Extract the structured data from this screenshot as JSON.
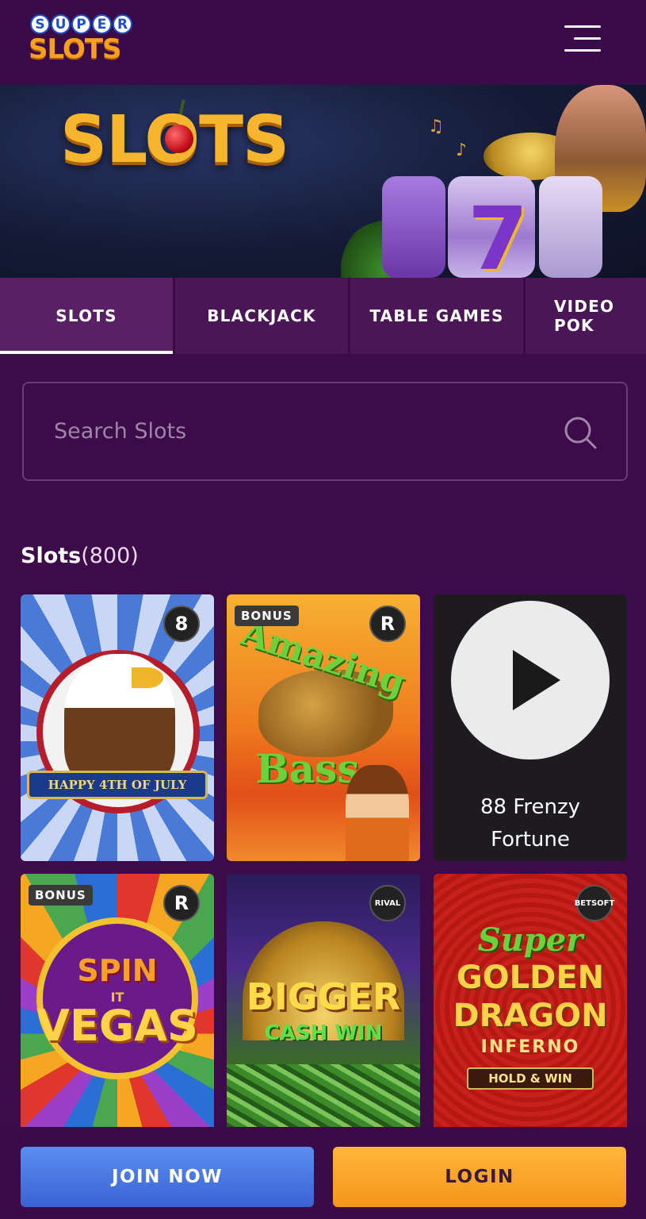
{
  "header": {
    "logo_top": "SUPER",
    "logo_bottom": "SLOTS",
    "menu_icon": "hamburger-menu-icon"
  },
  "hero": {
    "title": "SLOTS"
  },
  "tabs": [
    {
      "label": "SLOTS",
      "active": true
    },
    {
      "label": "BLACKJACK",
      "active": false
    },
    {
      "label": "TABLE GAMES",
      "active": false
    },
    {
      "label": "VIDEO POK",
      "active": false
    }
  ],
  "search": {
    "placeholder": "Search Slots",
    "value": "",
    "icon": "search-icon"
  },
  "section": {
    "title": "Slots",
    "count": "(800)"
  },
  "games": [
    {
      "name": "Happy 4th of July",
      "art_text": "HAPPY 4TH OF JULY",
      "provider": "8",
      "badge": ""
    },
    {
      "name": "Amazing Bass",
      "art_text_1": "Amazing",
      "art_text_2": "Bass",
      "provider": "R",
      "badge": "BONUS"
    },
    {
      "name": "88 Frenzy Fortune",
      "label_line1": "88 Frenzy",
      "label_line2": "Fortune",
      "play_icon": "play-icon"
    },
    {
      "name": "Spin It Vegas",
      "art_text_1": "SPIN",
      "art_text_2": "IT",
      "art_text_3": "VEGAS",
      "provider": "R",
      "badge": "BONUS"
    },
    {
      "name": "Bigger Cash Win",
      "art_text_1": "BIGGER",
      "art_text_2": "CASH WIN",
      "provider": "RIVAL",
      "badge": ""
    },
    {
      "name": "Super Golden Dragon Inferno",
      "art_text_1": "Super",
      "art_text_2": "GOLDEN",
      "art_text_3": "DRAGON",
      "art_text_4": "INFERNO",
      "art_text_5": "HOLD & WIN",
      "provider": "BETSOFT",
      "badge": ""
    }
  ],
  "bottom_bar": {
    "join_label": "JOIN NOW",
    "login_label": "LOGIN"
  },
  "colors": {
    "background": "#3d0a4a",
    "join_button": "#4a78e4",
    "login_button": "#f9a527"
  }
}
